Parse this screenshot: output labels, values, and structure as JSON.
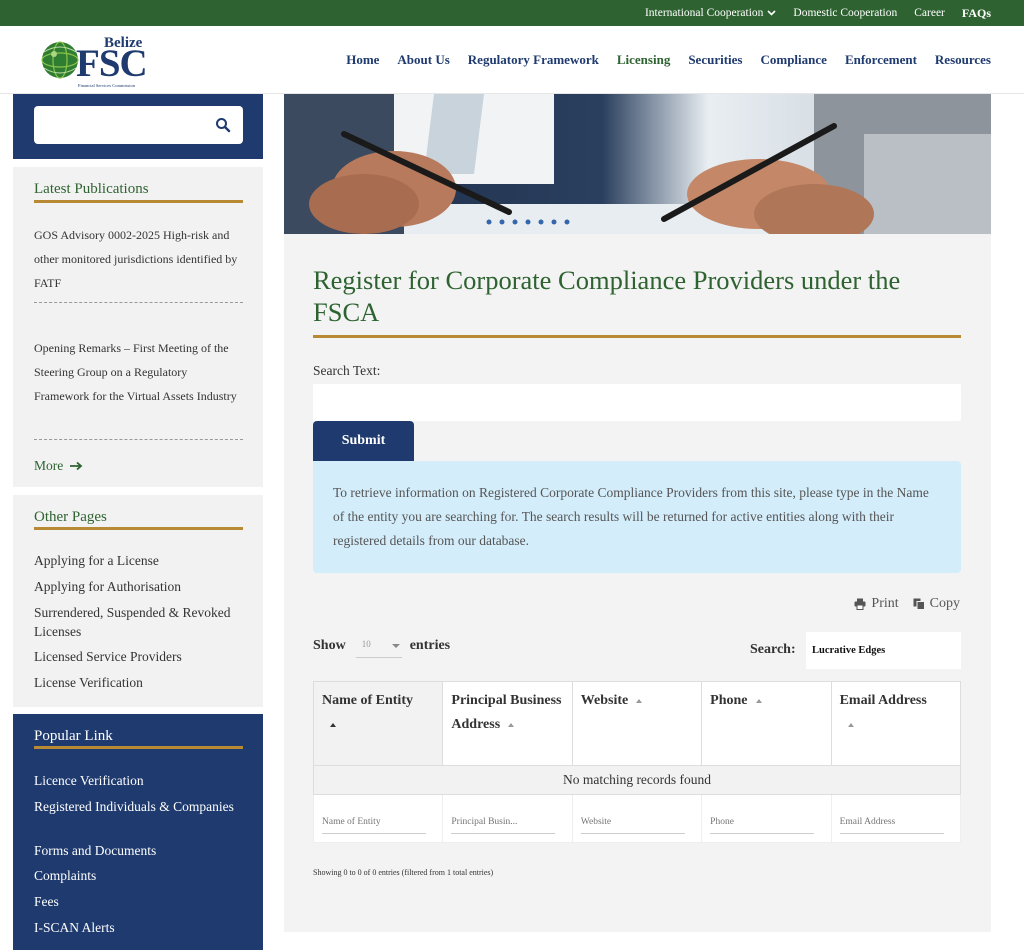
{
  "topbar": {
    "items": [
      {
        "label": "International Cooperation",
        "has_dropdown": true
      },
      {
        "label": "Domestic Cooperation"
      },
      {
        "label": "Career"
      },
      {
        "label": "FAQs"
      }
    ]
  },
  "header": {
    "logo": {
      "line1": "Belize",
      "line2": "FSC",
      "tagline": "Financial Services Commission"
    },
    "nav": [
      {
        "label": "Home"
      },
      {
        "label": "About Us"
      },
      {
        "label": "Regulatory Framework"
      },
      {
        "label": "Licensing",
        "active": true
      },
      {
        "label": "Securities"
      },
      {
        "label": "Compliance"
      },
      {
        "label": "Enforcement"
      },
      {
        "label": "Resources"
      }
    ]
  },
  "sidebar": {
    "search": {
      "value": "",
      "placeholder": ""
    },
    "latest_publications": {
      "title": "Latest Publications",
      "items": [
        "GOS Advisory 0002-2025 High-risk and other monitored jurisdictions identified by FATF",
        "Opening Remarks – First Meeting of the Steering Group on a Regulatory Framework for the Virtual Assets Industry"
      ],
      "more": "More"
    },
    "other_pages": {
      "title": "Other Pages",
      "items": [
        "Applying for a License",
        "Applying for Authorisation",
        "Surrendered, Suspended & Revoked Licenses",
        "Licensed Service Providers",
        "License Verification"
      ]
    },
    "popular_link": {
      "title": "Popular Link",
      "items": [
        "Licence Verification",
        "Registered Individuals & Companies",
        "Forms and Documents",
        "Complaints",
        "Fees",
        "I-SCAN Alerts"
      ]
    }
  },
  "main": {
    "title": "Register for Corporate Compliance Providers under the FSCA",
    "search_label": "Search Text:",
    "search_value": "",
    "submit_label": "Submit",
    "info_text": "To retrieve information on Registered Corporate Compliance Providers from this site, please type in the Name of the entity you are searching for. The search results will be returned for active entities along with their registered details from our database.",
    "actions": {
      "print": "Print",
      "copy": "Copy"
    },
    "show_label": "Show",
    "entries_label": "entries",
    "page_length": "10",
    "table_search_label": "Search:",
    "table_search_value": "Lucrative Edges",
    "table": {
      "columns": [
        "Name of Entity",
        "Principal Business Address",
        "Website",
        "Phone",
        "Email Address"
      ],
      "empty_message": "No matching records found",
      "filter_placeholders": [
        "Name of Entity",
        "Principal Busin...",
        "Website",
        "Phone",
        "Email Address"
      ]
    },
    "footer_info": "Showing 0 to 0 of 0 entries (filtered from 1 total entries)"
  },
  "colors": {
    "green": "#2e6331",
    "navy": "#1e3a6e",
    "gold": "#b98a34",
    "info_bg": "#d4edfa"
  }
}
